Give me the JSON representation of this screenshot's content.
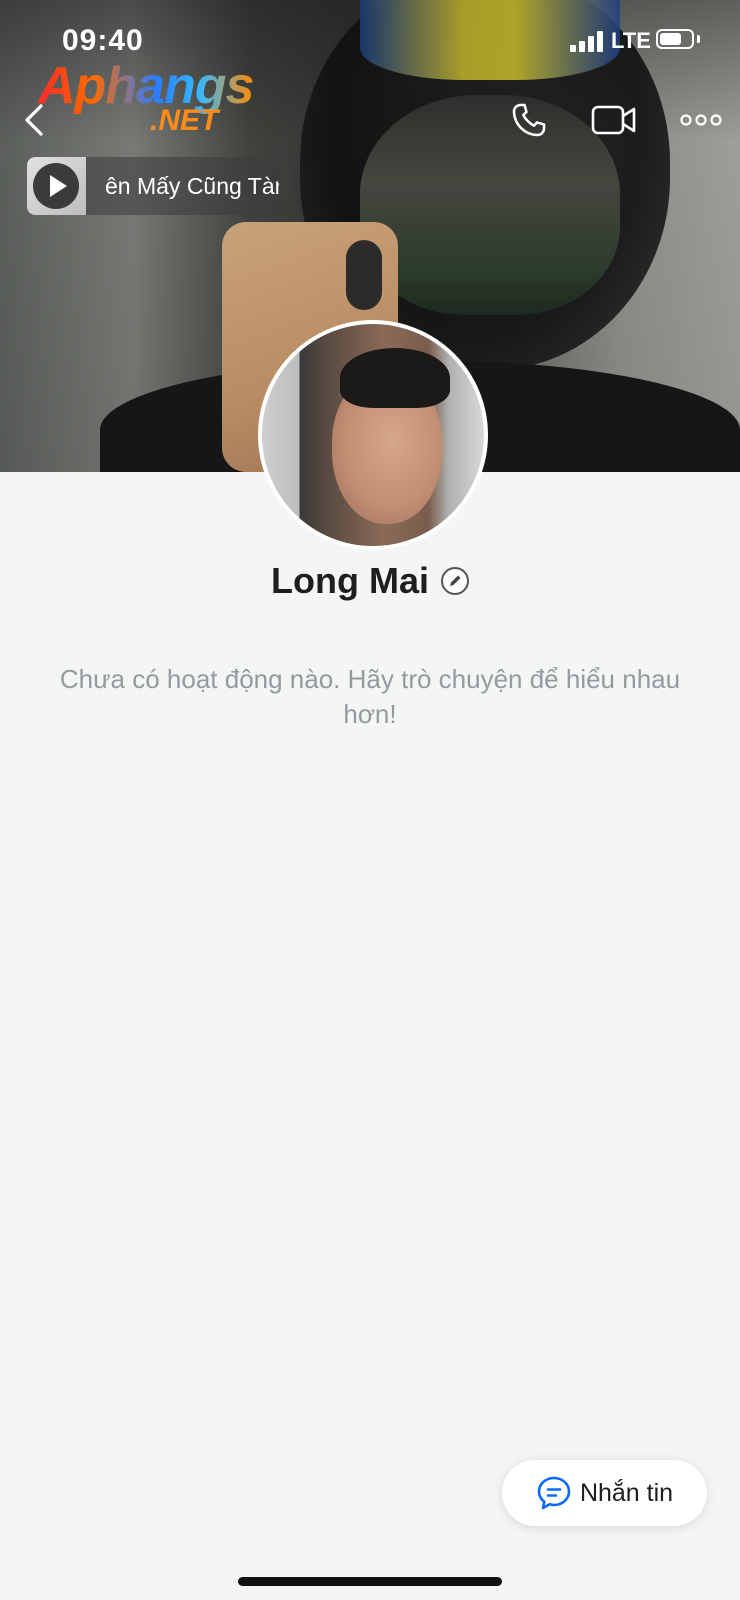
{
  "status_bar": {
    "time": "09:40",
    "network": "LTE",
    "battery_level": 0.7
  },
  "watermark": {
    "main": "Aphangs",
    "sub": ".NET"
  },
  "header": {
    "back_icon": "chevron-left-icon",
    "call_icon": "phone-icon",
    "video_icon": "video-camera-icon",
    "more_icon": "more-horizontal-icon"
  },
  "music": {
    "title": "ên Mấy Cũng Tàn",
    "icon": "play-icon"
  },
  "profile": {
    "name": "Long Mai",
    "edit_icon": "pencil-icon"
  },
  "feed": {
    "empty_message": "Chưa có hoạt động nào. Hãy trò chuyện để hiểu nhau hơn!"
  },
  "actions": {
    "message_label": "Nhắn tin",
    "message_icon": "chat-bubble-icon"
  },
  "colors": {
    "accent": "#0a68ff",
    "background": "#f4f5f5",
    "secondary_text": "#959a9f"
  }
}
